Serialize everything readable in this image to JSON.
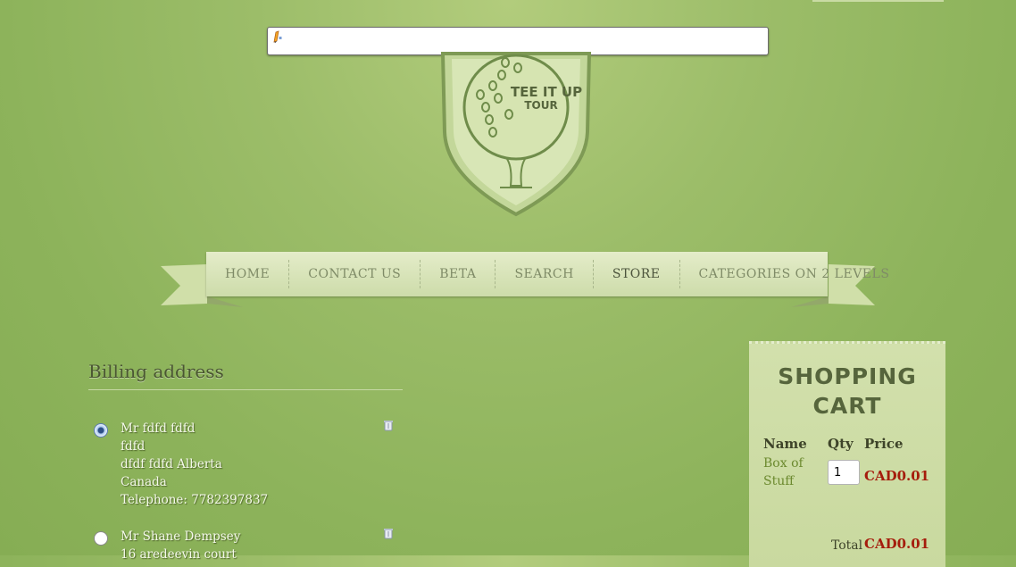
{
  "nav": {
    "items": [
      "HOME",
      "CONTACT US",
      "BETA",
      "SEARCH",
      "STORE",
      "CATEGORIES ON 2 LEVELS"
    ]
  },
  "logo": {
    "line1": "TEE IT UP",
    "line2": "TOUR"
  },
  "billing": {
    "title": "Billing address",
    "addresses": [
      {
        "lines": [
          "Mr fdfd fdfd",
          "fdfd",
          "dfdf fdfd Alberta",
          "Canada",
          "Telephone: 7782397837"
        ],
        "selected": true
      },
      {
        "lines": [
          "Mr Shane Dempsey",
          "16 aredeevin court"
        ],
        "selected": false
      }
    ]
  },
  "cart": {
    "title_line1": "SHOPPING",
    "title_line2": "CART",
    "headers": {
      "name": "Name",
      "qty": "Qty",
      "price": "Price"
    },
    "item": {
      "name_line1": "Box of",
      "name_line2": "Stuff",
      "qty": "1",
      "price": "CAD0.01"
    },
    "total_label": "Total",
    "total_value": "CAD0.01"
  }
}
